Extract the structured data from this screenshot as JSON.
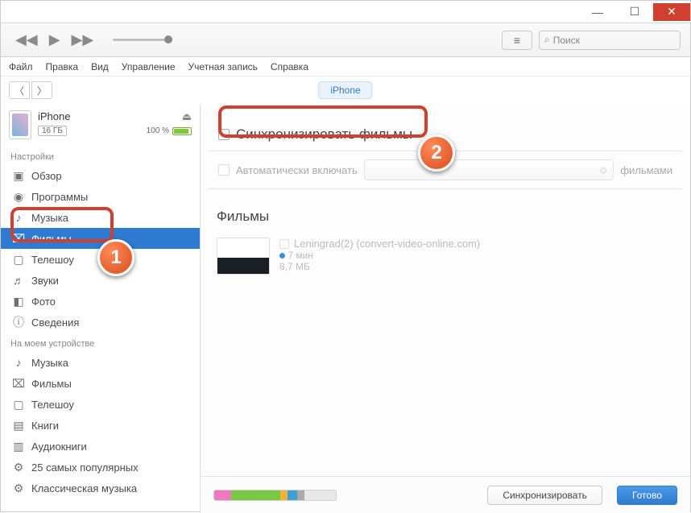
{
  "window": {
    "minimize": "—",
    "maximize": "☐",
    "close": "✕"
  },
  "toolbar": {
    "list_btn": "≡",
    "search_placeholder": "Поиск",
    "search_icon": "⌕"
  },
  "menubar": [
    "Файл",
    "Правка",
    "Вид",
    "Управление",
    "Учетная запись",
    "Справка"
  ],
  "nav_pill": "iPhone",
  "device": {
    "name": "iPhone",
    "capacity": "16 ГБ",
    "battery_pct": "100 %",
    "eject_glyph": "⏏"
  },
  "sidebar": {
    "sections": [
      {
        "title": "Настройки",
        "items": [
          {
            "label": "Обзор",
            "icon": "▣"
          },
          {
            "label": "Программы",
            "icon": "◉"
          },
          {
            "label": "Музыка",
            "icon": "♪"
          },
          {
            "label": "Фильмы",
            "icon": "⌧",
            "active": true
          },
          {
            "label": "Телешоу",
            "icon": "▢"
          },
          {
            "label": "Звуки",
            "icon": "♬"
          },
          {
            "label": "Фото",
            "icon": "◧"
          },
          {
            "label": "Сведения",
            "icon": "ⓘ"
          }
        ]
      },
      {
        "title": "На моем устройстве",
        "items": [
          {
            "label": "Музыка",
            "icon": "♪"
          },
          {
            "label": "Фильмы",
            "icon": "⌧"
          },
          {
            "label": "Телешоу",
            "icon": "▢"
          },
          {
            "label": "Книги",
            "icon": "▤"
          },
          {
            "label": "Аудиокниги",
            "icon": "▥"
          },
          {
            "label": "25 самых популярных",
            "icon": "⚙"
          },
          {
            "label": "Классическая музыка",
            "icon": "⚙"
          }
        ]
      }
    ]
  },
  "content": {
    "sync_label": "Синхронизировать фильмы",
    "auto_label": "Автоматически включать",
    "auto_suffix": "фильмами",
    "section_title": "Фильмы",
    "movie": {
      "title": "Leningrad(2) (convert-video-online.com)",
      "duration": "7 мин",
      "size": "8,7 МБ"
    }
  },
  "footer": {
    "sync_btn": "Синхронизировать",
    "done_btn": "Готово",
    "segments": [
      {
        "color": "#f078c0",
        "w": "14%"
      },
      {
        "color": "#7ac943",
        "w": "40%"
      },
      {
        "color": "#f5b13d",
        "w": "6%"
      },
      {
        "color": "#3aa0d6",
        "w": "8%"
      },
      {
        "color": "#aaaaaa",
        "w": "6%"
      },
      {
        "color": "#e8e8e8",
        "w": "26%"
      }
    ]
  },
  "callouts": {
    "one": "1",
    "two": "2"
  }
}
